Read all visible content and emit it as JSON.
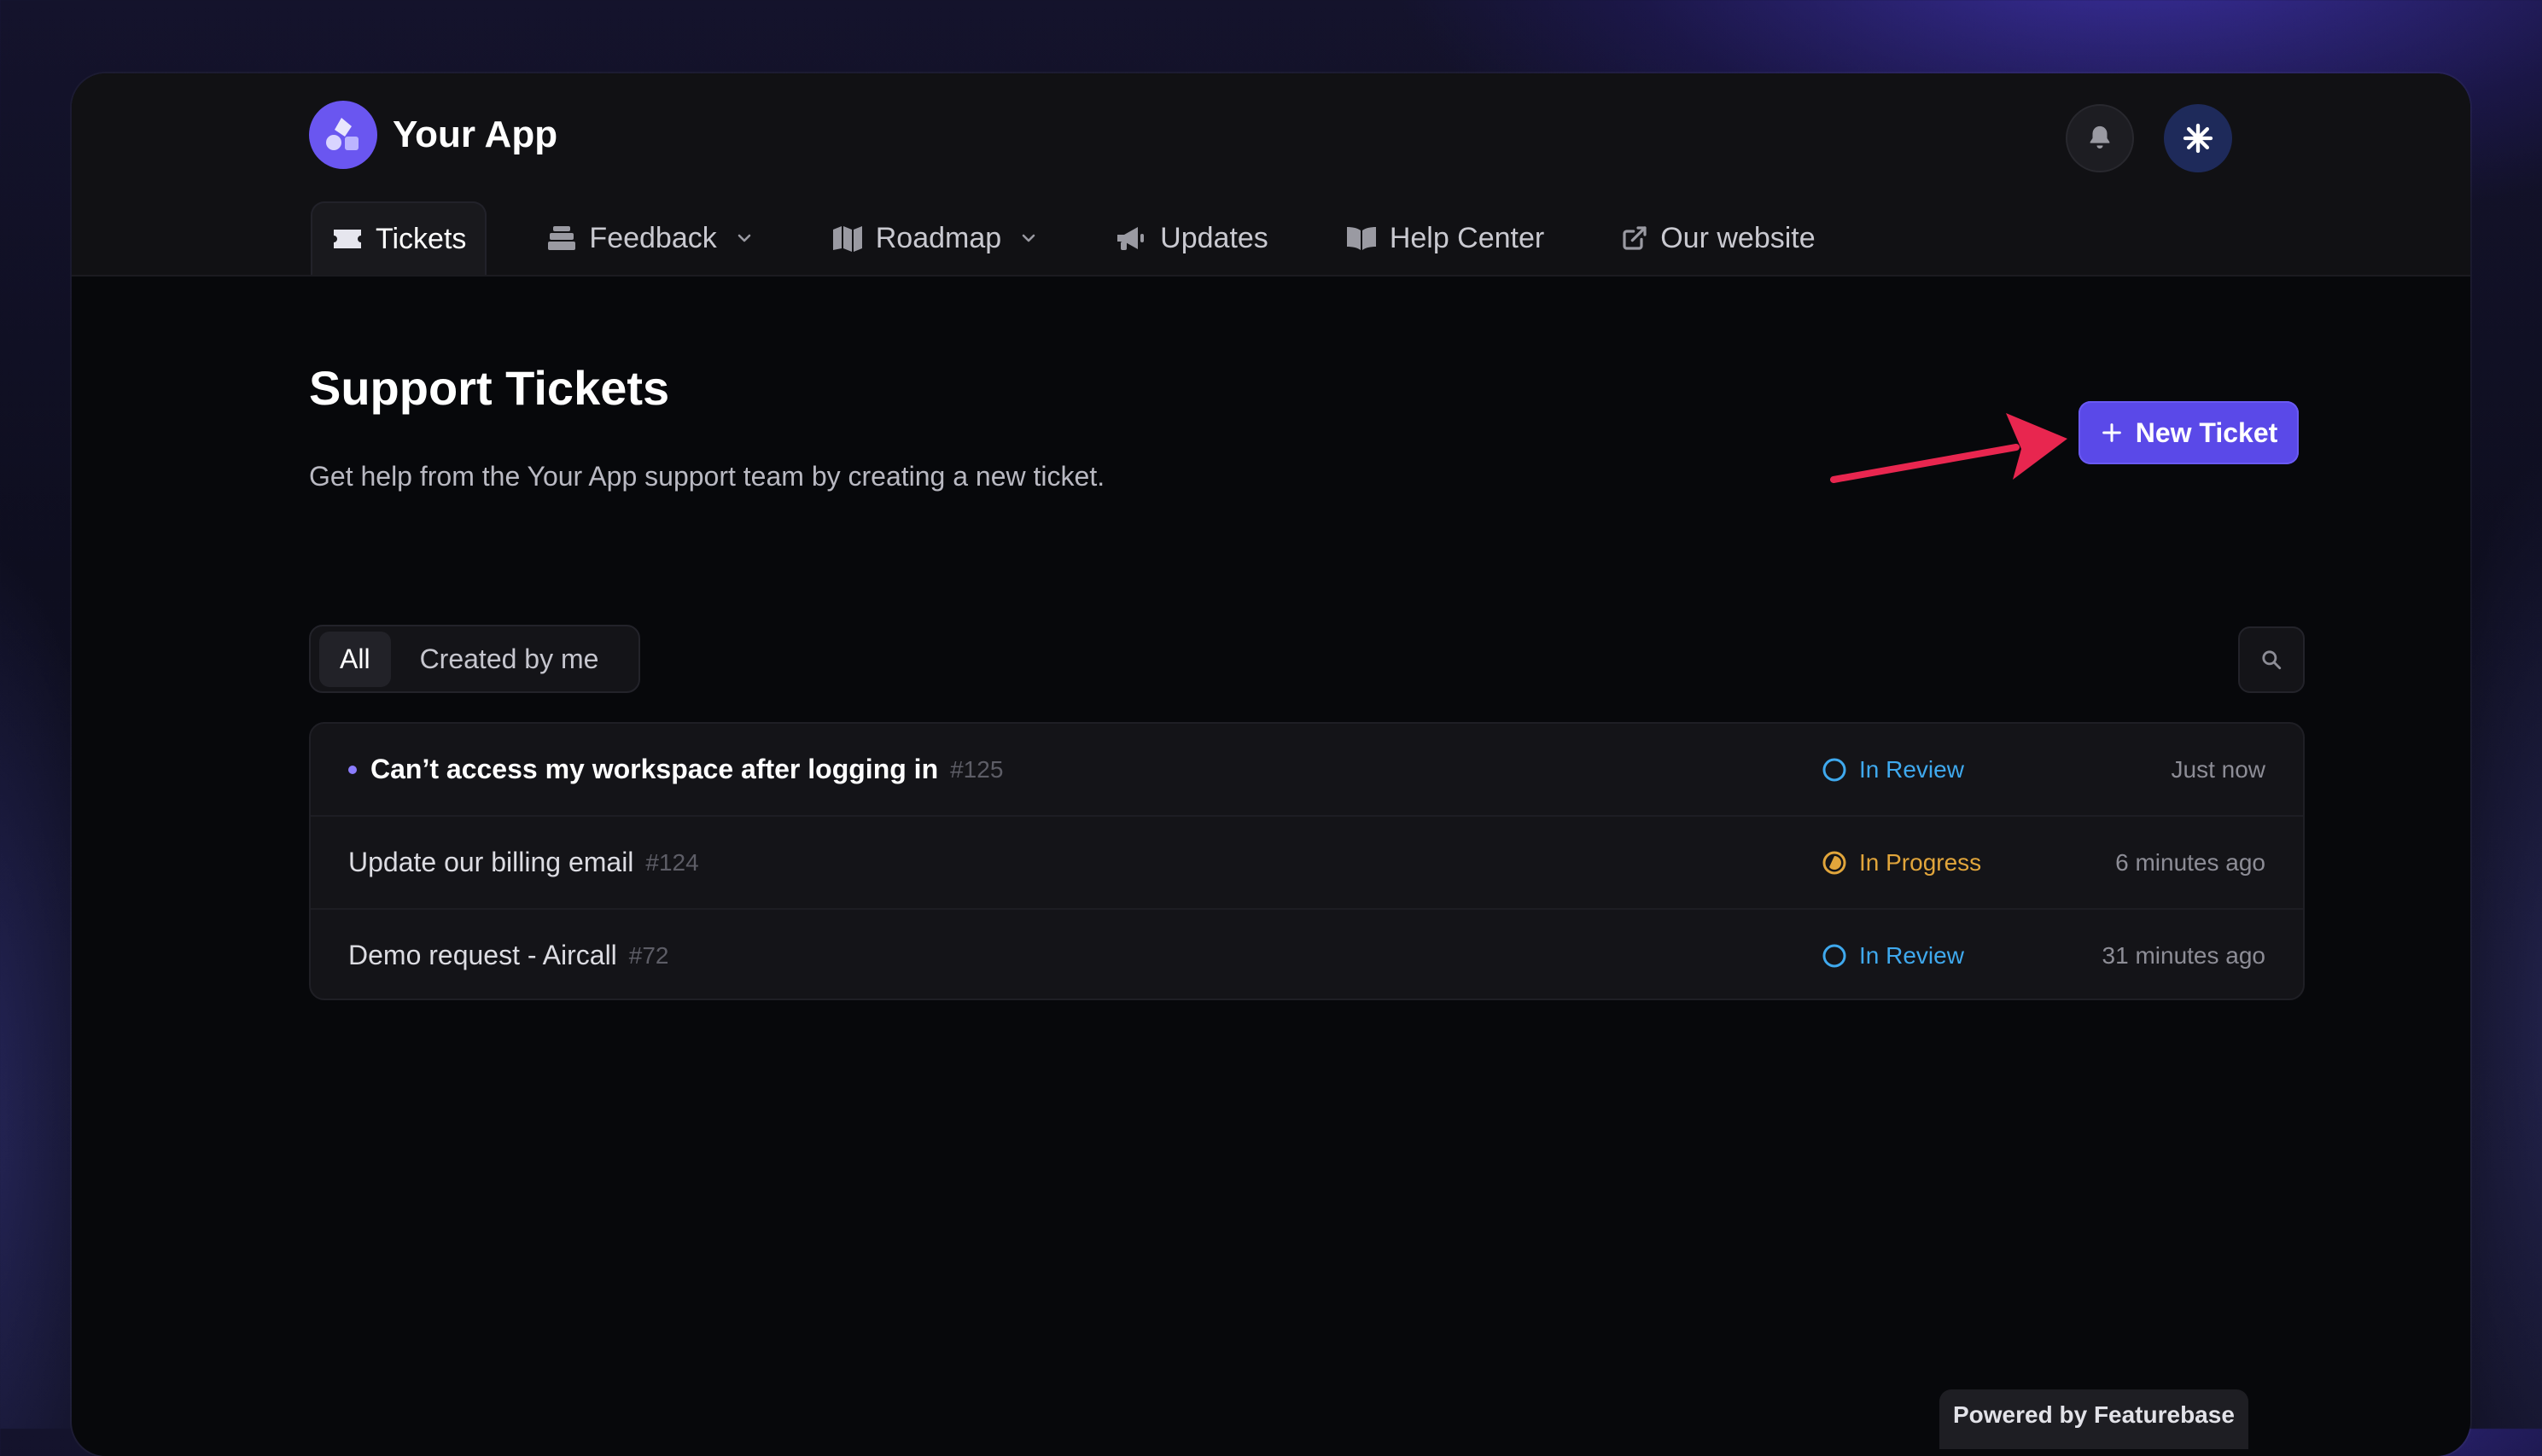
{
  "app": {
    "name": "Your App"
  },
  "nav": {
    "items": [
      {
        "label": "Tickets"
      },
      {
        "label": "Feedback"
      },
      {
        "label": "Roadmap"
      },
      {
        "label": "Updates"
      },
      {
        "label": "Help Center"
      },
      {
        "label": "Our website"
      }
    ]
  },
  "page": {
    "title": "Support Tickets",
    "subtitle": "Get help from the Your App support team by creating a new ticket.",
    "new_ticket_label": "New Ticket"
  },
  "filters": {
    "all": "All",
    "created_by_me": "Created by me"
  },
  "tickets": [
    {
      "title": "Can’t access my workspace after logging in",
      "id": "#125",
      "status": "In Review",
      "time": "Just now"
    },
    {
      "title": "Update our billing email",
      "id": "#124",
      "status": "In Progress",
      "time": "6 minutes ago"
    },
    {
      "title": "Demo request - Aircall",
      "id": "#72",
      "status": "In Review",
      "time": "31 minutes ago"
    }
  ],
  "footer": {
    "powered_by": "Powered by Featurebase"
  },
  "colors": {
    "accent": "#5a49e8",
    "in_review": "#3fa9ee",
    "in_progress": "#e1a53b",
    "annotation_arrow": "#e8264f"
  },
  "icons": [
    "bell-icon",
    "sparkle-icon",
    "ticket-icon",
    "feedback-icon",
    "roadmap-icon",
    "megaphone-icon",
    "book-icon",
    "external-link-icon",
    "plus-icon",
    "search-icon",
    "chevron-down-icon"
  ]
}
